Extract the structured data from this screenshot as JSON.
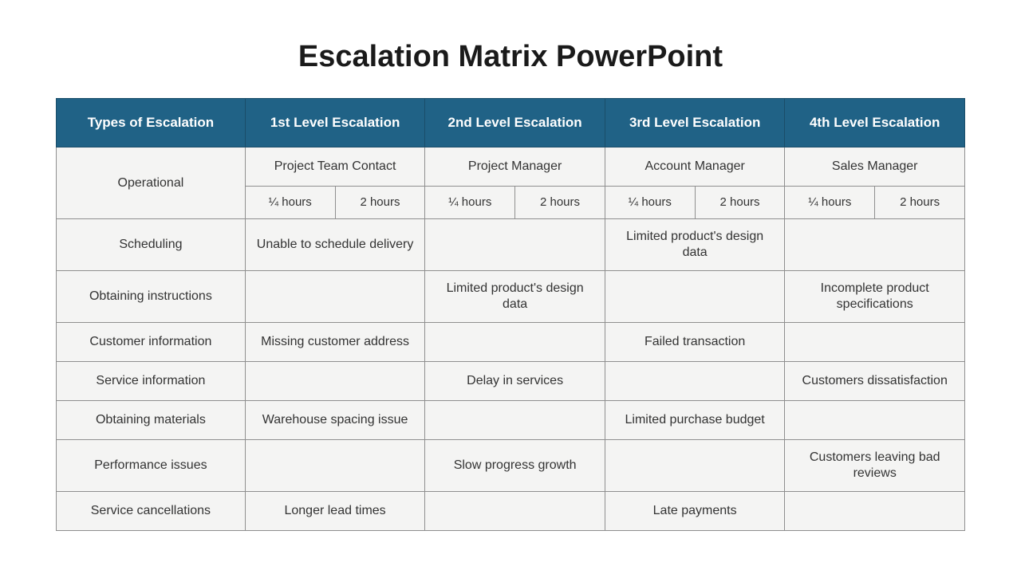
{
  "title": "Escalation Matrix PowerPoint",
  "headers": {
    "type": "Types of Escalation",
    "l1": "1st Level Escalation",
    "l2": "2nd Level Escalation",
    "l3": "3rd Level Escalation",
    "l4": "4th Level Escalation"
  },
  "operational": {
    "label": "Operational",
    "contacts": {
      "l1": "Project Team Contact",
      "l2": "Project Manager",
      "l3": "Account Manager",
      "l4": "Sales Manager"
    },
    "times": {
      "l1a": "¼ hours",
      "l1b": "2 hours",
      "l2a": "¼ hours",
      "l2b": "2 hours",
      "l3a": "¼ hours",
      "l3b": "2 hours",
      "l4a": "¼ hours",
      "l4b": "2 hours"
    }
  },
  "rows": {
    "scheduling": {
      "label": "Scheduling",
      "l1": "Unable to schedule delivery",
      "l2": "",
      "l3": "Limited product's design data",
      "l4": ""
    },
    "obtaining": {
      "label": "Obtaining instructions",
      "l1": "",
      "l2": "Limited product's design data",
      "l3": "",
      "l4": "Incomplete product specifications"
    },
    "customer": {
      "label": "Customer information",
      "l1": "Missing customer address",
      "l2": "",
      "l3": "Failed transaction",
      "l4": ""
    },
    "service": {
      "label": "Service information",
      "l1": "",
      "l2": "Delay in services",
      "l3": "",
      "l4": "Customers dissatisfaction"
    },
    "materials": {
      "label": "Obtaining materials",
      "l1": "Warehouse spacing issue",
      "l2": "",
      "l3": "Limited purchase budget",
      "l4": ""
    },
    "performance": {
      "label": "Performance issues",
      "l1": "",
      "l2": "Slow progress growth",
      "l3": "",
      "l4": "Customers leaving bad reviews"
    },
    "cancel": {
      "label": "Service cancellations",
      "l1": "Longer lead times",
      "l2": "",
      "l3": "Late payments",
      "l4": ""
    }
  }
}
